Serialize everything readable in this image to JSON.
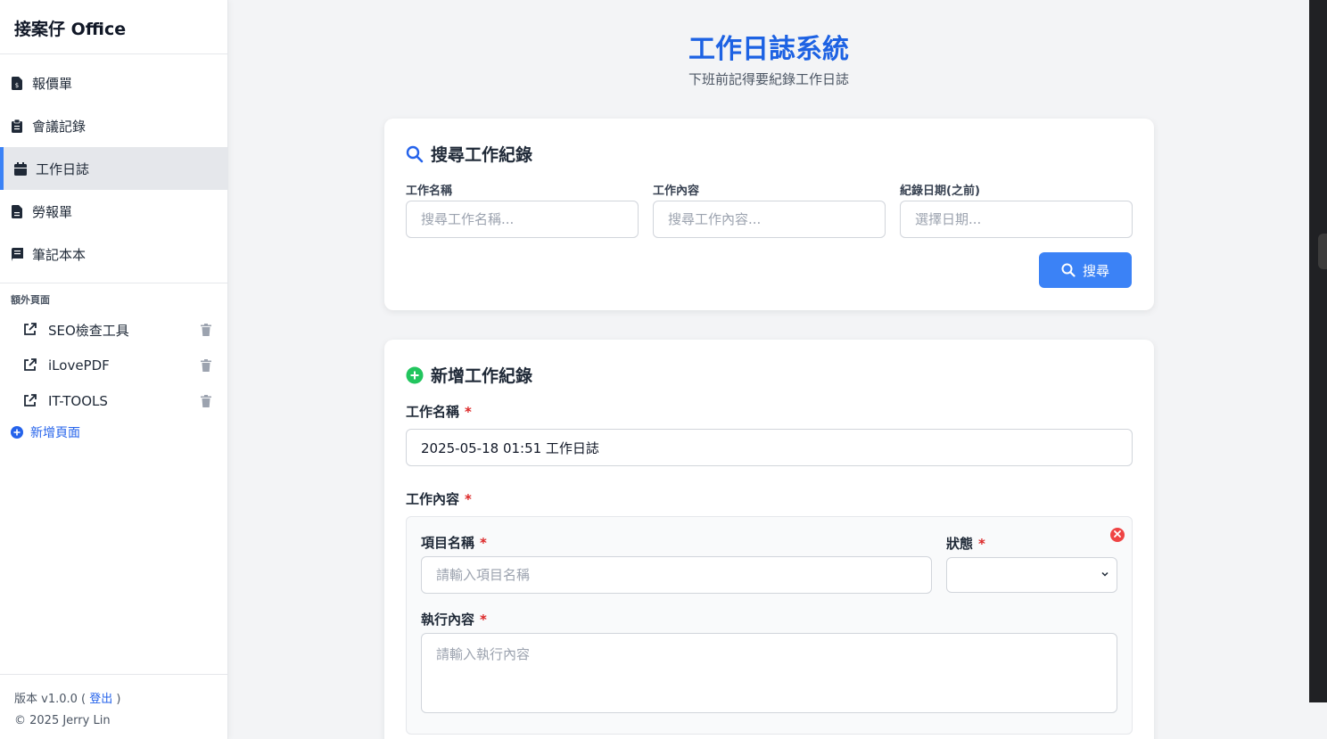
{
  "app": {
    "brand": "接案仔 Office"
  },
  "sidebar": {
    "items": [
      {
        "label": "報價單",
        "icon": "invoice-dollar-icon"
      },
      {
        "label": "會議記錄",
        "icon": "clipboard-icon"
      },
      {
        "label": "工作日誌",
        "icon": "calendar-icon",
        "active": true
      },
      {
        "label": "勞報單",
        "icon": "document-icon"
      },
      {
        "label": "筆記本本",
        "icon": "book-icon"
      }
    ],
    "extra_title": "額外頁面",
    "extra_items": [
      {
        "label": "SEO檢查工具",
        "icon": "external-link-icon"
      },
      {
        "label": "iLovePDF",
        "icon": "external-link-icon"
      },
      {
        "label": "IT-TOOLS",
        "icon": "external-link-icon"
      }
    ],
    "add_page": "新增頁面",
    "footer": {
      "version_prefix": "版本 v1.0.0 (",
      "logout": "登出",
      "version_suffix": ")",
      "copyright": "© 2025 Jerry Lin"
    }
  },
  "main": {
    "title": "工作日誌系統",
    "subtitle": "下班前記得要紀錄工作日誌",
    "search": {
      "title": "搜尋工作紀錄",
      "name_label": "工作名稱",
      "name_placeholder": "搜尋工作名稱...",
      "content_label": "工作內容",
      "content_placeholder": "搜尋工作內容...",
      "date_label": "紀錄日期(之前)",
      "date_placeholder": "選擇日期...",
      "button": "搜尋"
    },
    "add": {
      "title": "新增工作紀錄",
      "name_label": "工作名稱",
      "name_value": "2025-05-18 01:51 工作日誌",
      "content_label": "工作內容",
      "required_mark": "*",
      "item": {
        "project_label": "項目名稱",
        "project_placeholder": "請輸入項目名稱",
        "status_label": "狀態",
        "status_value": "",
        "exec_label": "執行內容",
        "exec_placeholder": "請輸入執行內容"
      }
    }
  },
  "colors": {
    "accent": "#3b82f6",
    "title": "#1d62e3",
    "add_icon": "#22c55e",
    "danger": "#ef4444"
  }
}
